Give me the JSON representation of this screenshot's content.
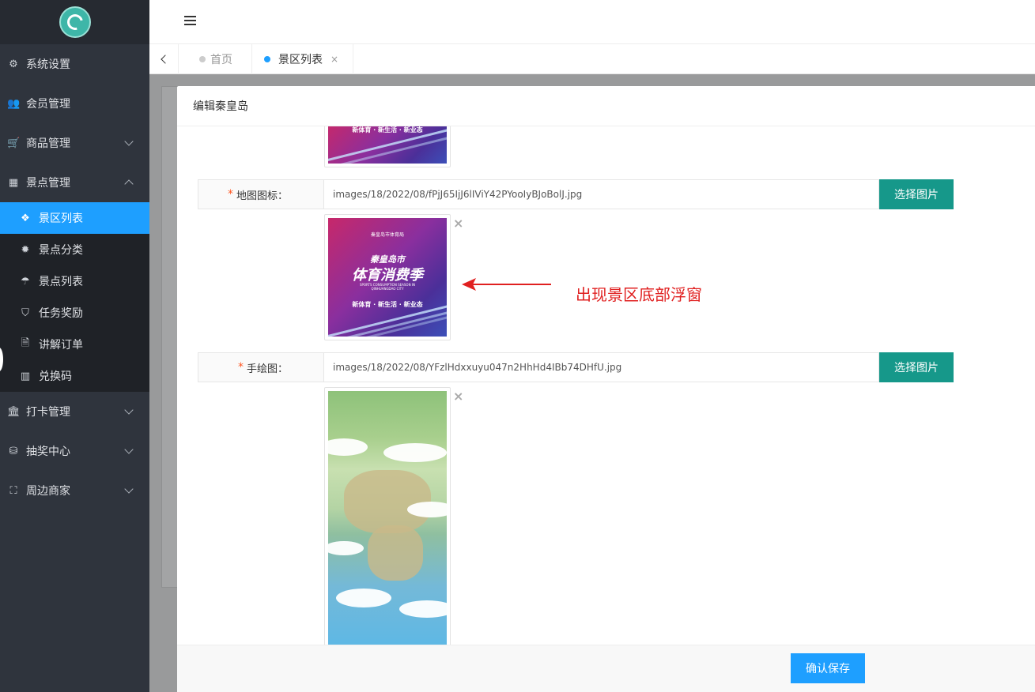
{
  "sidebar": {
    "items": [
      {
        "label": "系统设置",
        "icon": "gears-icon"
      },
      {
        "label": "会员管理",
        "icon": "users-icon"
      },
      {
        "label": "商品管理",
        "icon": "cart-icon",
        "chevron": "down"
      },
      {
        "label": "景点管理",
        "icon": "grid-icon",
        "chevron": "up"
      }
    ],
    "sub_items": [
      {
        "label": "景区列表",
        "icon": "cubes-icon",
        "active": true
      },
      {
        "label": "景点分类",
        "icon": "gear-icon"
      },
      {
        "label": "景点列表",
        "icon": "umbrella-icon"
      },
      {
        "label": "任务奖励",
        "icon": "shield-icon"
      },
      {
        "label": "讲解订单",
        "icon": "document-icon"
      },
      {
        "label": "兑换码",
        "icon": "barcode-icon"
      }
    ],
    "items_after": [
      {
        "label": "打卡管理",
        "icon": "bank-icon",
        "chevron": "down"
      },
      {
        "label": "抽奖中心",
        "icon": "database-icon",
        "chevron": "down"
      },
      {
        "label": "周边商家",
        "icon": "sitemap-icon",
        "chevron": "down"
      }
    ]
  },
  "tabs": [
    {
      "label": "首页",
      "active": false
    },
    {
      "label": "景区列表",
      "active": true,
      "close": "×"
    }
  ],
  "modal": {
    "title": "编辑秦皇岛",
    "fields": [
      {
        "label": "地图图标：",
        "value": "images/18/2022/08/fPjJ65IjJ6lIViY42PYooIyBJoBolJ.jpg",
        "button": "选择图片"
      },
      {
        "label": "手绘图：",
        "value": "images/18/2022/08/YFzlHdxxuyu047n2HhHd4IBb74DHfU.jpg",
        "button": "选择图片"
      }
    ],
    "required_mark": "*",
    "remove": "×",
    "poster": {
      "top_text": "秦皇岛市体育局",
      "line1": "秦皇岛市",
      "line2": "体育消费季",
      "sub": "SPORTS CONSUMPTION SEASON IN QINHUANGDAO CITY",
      "bottom": "新体育 · 新生活 · 新业态"
    },
    "save_button": "确认保存"
  },
  "annotation": {
    "text": "出现景区底部浮窗",
    "color": "#e02020"
  },
  "colors": {
    "sidebar_bg": "#2f343d",
    "active_blue": "#1e9fff",
    "teal_button": "#16988a",
    "required": "#ff5722"
  }
}
